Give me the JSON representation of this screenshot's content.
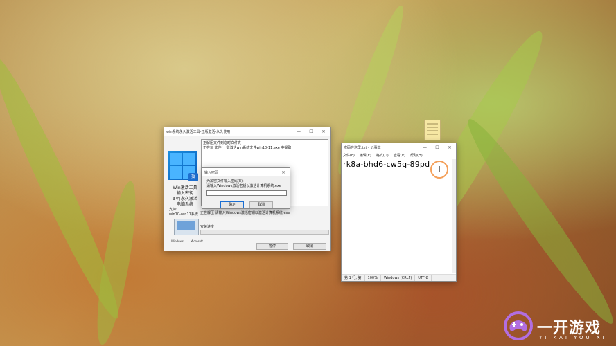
{
  "activation_window": {
    "title": "win系统永久激活工具-正版激活-永久使用!",
    "controls": [
      "—",
      "☐",
      "✕"
    ],
    "caption_lines": [
      "Win激活工具",
      "输入密钥",
      "即可永久激活",
      "电脑系统"
    ],
    "support_lines": [
      "支持:",
      "win10-win11系统"
    ],
    "laptop_logos": [
      "Windows",
      "Microsoft"
    ],
    "log_lines": [
      "正解压文件到临时文件夹",
      "正在运 文件(一键激活win系统文件win10-11.exe 中提取"
    ],
    "status_text": "正在解压 请输入Windows激活密钥以激活计算机系统.exe",
    "progress_label": "安装进度",
    "progress": 0,
    "pause_button": "暂停",
    "cancel_button": "取消"
  },
  "password_dialog": {
    "title": "输入密码",
    "close": "✕",
    "line1": "为加密文件输入密码(E):",
    "line2": "请输入Windows激活密钥以激活计算机系统.exe",
    "input_value": "",
    "ok_button": "确定",
    "cancel_button": "取消"
  },
  "notepad": {
    "title": "密码在这里.txt - 记事本",
    "controls": [
      "—",
      "☐",
      "✕"
    ],
    "menu": [
      "文件(F)",
      "编辑(E)",
      "格式(O)",
      "查看(V)",
      "帮助(H)"
    ],
    "content": "rk8a-bhd6-cw5q-89pd",
    "cursor_glyph": "I",
    "status": [
      "第 1 行, 第",
      "100%",
      "Windows (CRLF)",
      "UTF-8"
    ]
  },
  "watermark": {
    "name": "一开游戏",
    "subtitle": "YI KAI YOU XI"
  },
  "colors": {
    "progress_fill": "#06b025",
    "accent_blue": "#1b6fd3",
    "cursor_ring": "#f4a05a"
  }
}
